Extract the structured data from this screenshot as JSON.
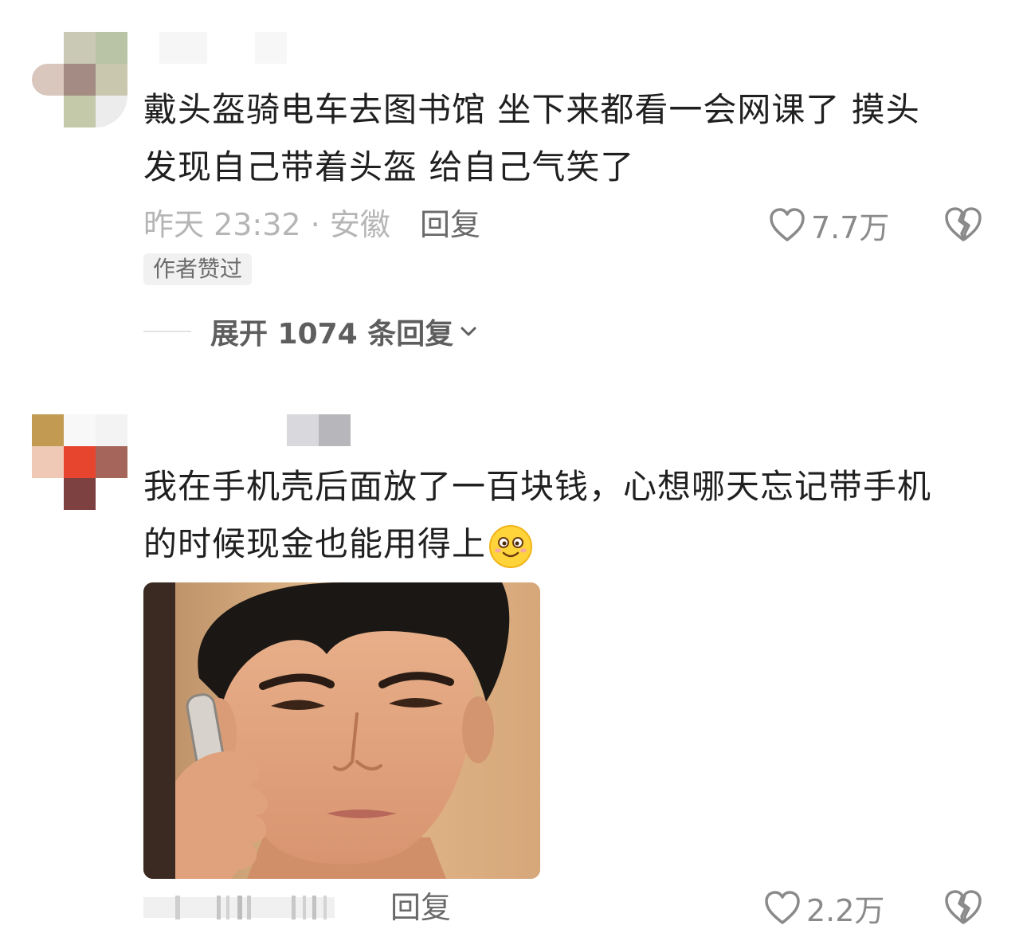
{
  "comments": [
    {
      "text_line1": "戴头盔骑电车去图书馆  坐下来都看一会网课了  摸头",
      "text_line2": "发现自己带着头盔  给自己气笑了",
      "time_location": "昨天 23:32 · 安徽",
      "reply_label": "回复",
      "like_count": "7.7万",
      "badge": "作者赞过",
      "expand_label": "展开 1074 条回复"
    },
    {
      "text_line1": "我在手机壳后面放了一百块钱，心想哪天忘记带手机",
      "text_line2": "的时候现金也能用得上",
      "emoji": "smiling-face-emoji",
      "image": "man-on-phone-photo",
      "reply_label": "回复",
      "like_count": "2.2万"
    }
  ],
  "colors": {
    "text": "#202020",
    "meta": "#b5b5b5",
    "action": "#8a8a8a",
    "badge_bg": "#f1f1f1"
  }
}
